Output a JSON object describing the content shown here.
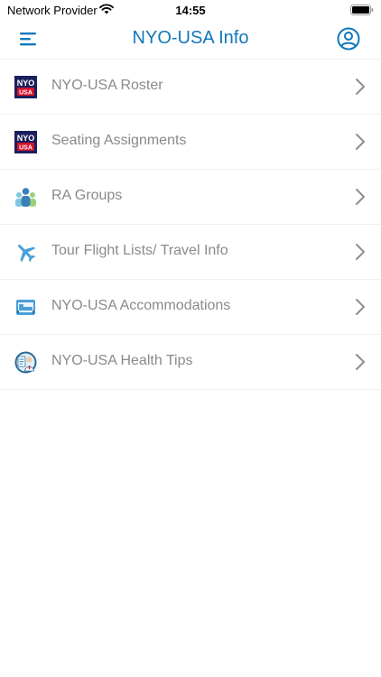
{
  "status_bar": {
    "carrier": "Network Provider",
    "time": "14:55"
  },
  "nav": {
    "title": "NYO-USA Info"
  },
  "colors": {
    "accent": "#1177bb",
    "label": "#8a8a8e",
    "chevron": "#8e8e93",
    "logo_navy": "#1b1f5c",
    "logo_red": "#d3122c"
  },
  "icons": {
    "menu": "menu-icon",
    "profile": "user-profile-icon",
    "chevron": "chevron-right-icon"
  },
  "menu_items": [
    {
      "label": "NYO-USA Roster",
      "icon": "nyo-usa-logo-icon"
    },
    {
      "label": "Seating Assignments",
      "icon": "nyo-usa-logo-icon"
    },
    {
      "label": "RA Groups",
      "icon": "group-people-icon"
    },
    {
      "label": "Tour Flight Lists/ Travel Info",
      "icon": "airplane-icon"
    },
    {
      "label": "NYO-USA Accommodations",
      "icon": "hotel-bed-icon"
    },
    {
      "label": "NYO-USA Health Tips",
      "icon": "health-doctor-icon"
    }
  ]
}
